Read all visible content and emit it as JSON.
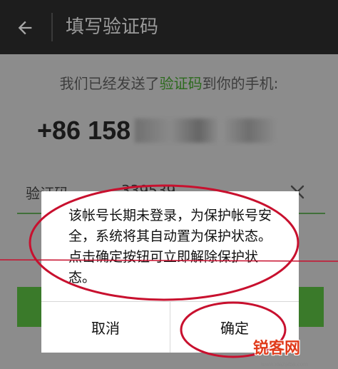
{
  "header": {
    "title": "填写验证码",
    "back_icon": "arrow-left-icon"
  },
  "page": {
    "sent_prefix": "我们已经发送了",
    "sent_highlight": "验证码",
    "sent_suffix": "到你的手机:",
    "phone_prefix": "+86 158",
    "code_label": "验证码",
    "code_value": "339539",
    "clear_icon": "close-icon"
  },
  "dialog": {
    "message": "该帐号长期未登录，为保护帐号安全，系统将其自动置为保护状态。点击确定按钮可立即解除保护状态。",
    "cancel_label": "取消",
    "ok_label": "确定"
  },
  "watermark": {
    "text": "锐客网",
    "subtext": "www.xiazaiba.com"
  },
  "colors": {
    "app_bar": "#1d1d1d",
    "accent_green": "#3a7a2a",
    "annotation_red": "#c8102e",
    "dim_background": "#8c8c8c"
  }
}
